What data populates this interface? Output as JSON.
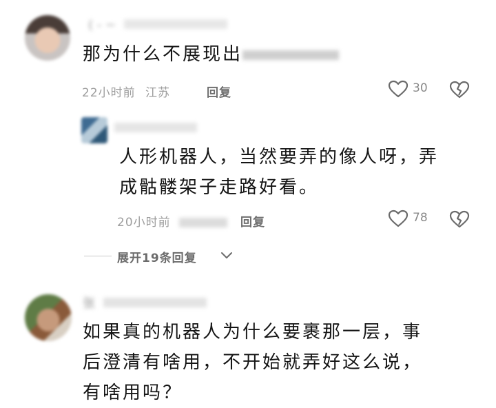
{
  "comments": [
    {
      "username": "( - ~",
      "text": "那为什么不展现出",
      "time": "22小时前",
      "location": "江苏",
      "reply_label": "回复",
      "likes": "30",
      "replies": [
        {
          "text_line1": "人形机器人，当然要弄的像人呀，弄",
          "text_line2": "成骷髅架子走路好看。",
          "time": "20小时前",
          "reply_label": "回复",
          "likes": "78"
        }
      ],
      "expand_label": "展开19条回复"
    },
    {
      "username": "张",
      "text_line1": "如果真的机器人为什么要裹那一层，事",
      "text_line2": "后澄清有啥用，不开始就弄好这么说，",
      "text_line3": "有啥用吗？"
    }
  ],
  "icons": {
    "like": "heart-icon",
    "dislike": "broken-heart-icon",
    "expand": "chevron-down-icon"
  }
}
